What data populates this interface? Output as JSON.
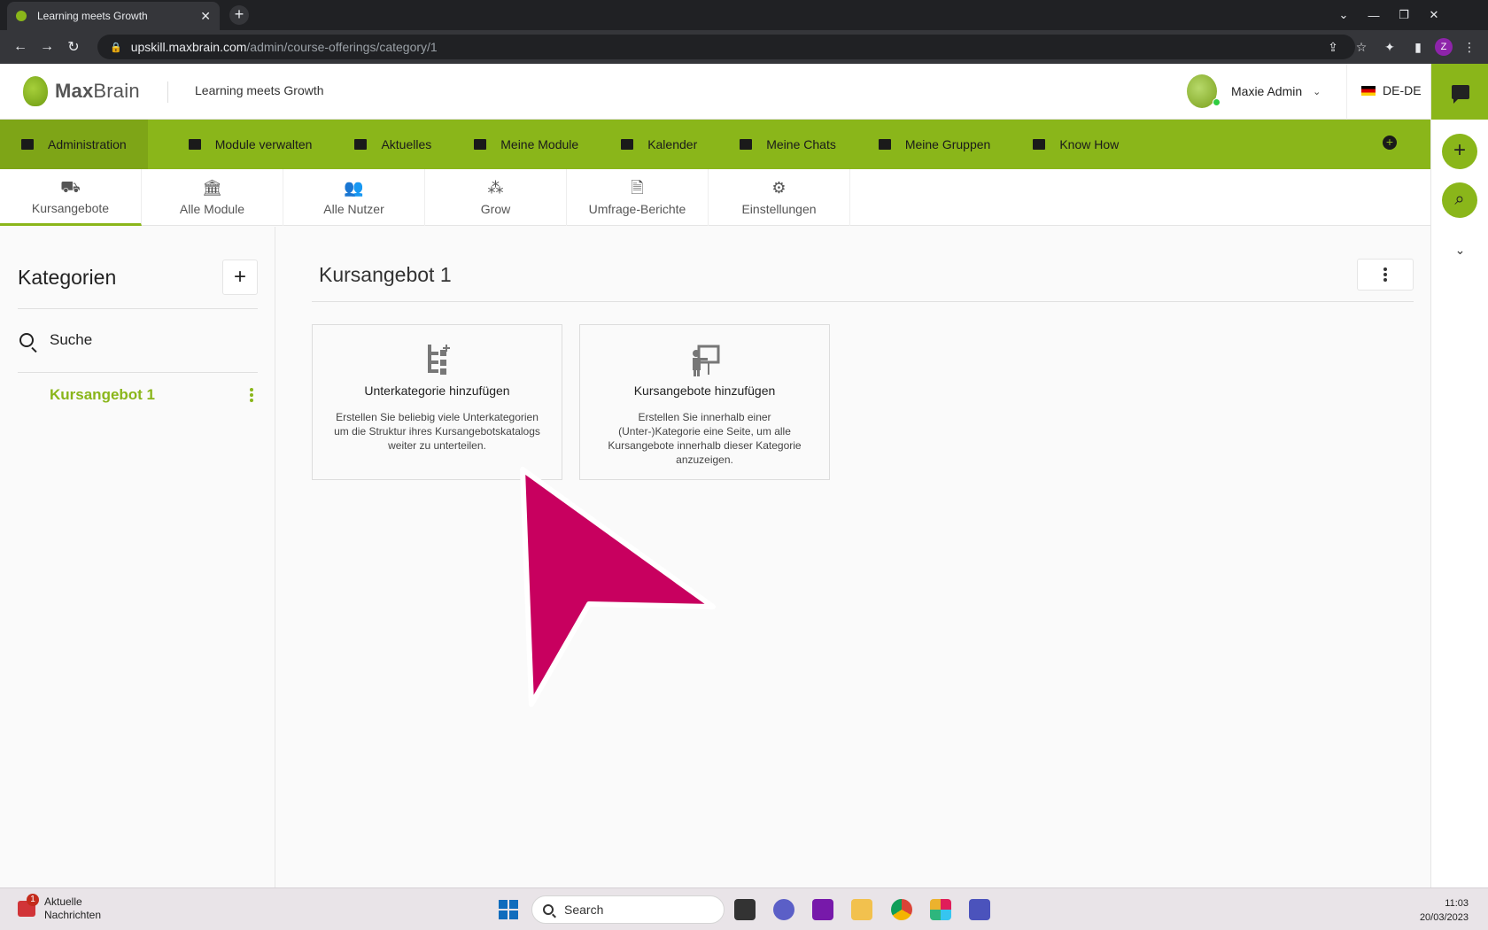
{
  "browser": {
    "tab_title": "Learning meets Growth",
    "url_host": "upskill.maxbrain.com",
    "url_path": "/admin/course-offerings/category/1",
    "profile_initial": "Z"
  },
  "header": {
    "logo_bold": "Max",
    "logo_light": "Brain",
    "tagline": "Learning meets Growth",
    "user_name": "Maxie Admin",
    "language": "DE-DE"
  },
  "nav": {
    "items": [
      {
        "label": "Administration",
        "icon": "dashboard-icon"
      },
      {
        "label": "Module verwalten",
        "icon": "module-manage-icon"
      },
      {
        "label": "Aktuelles",
        "icon": "news-icon"
      },
      {
        "label": "Meine Module",
        "icon": "graduation-cap-icon"
      },
      {
        "label": "Kalender",
        "icon": "calendar-icon"
      },
      {
        "label": "Meine Chats",
        "icon": "chat-screen-icon"
      },
      {
        "label": "Meine Gruppen",
        "icon": "groups-icon"
      },
      {
        "label": "Know How",
        "icon": "book-icon"
      }
    ]
  },
  "subtabs": [
    {
      "label": "Kursangebote",
      "icon": "course-offering-icon"
    },
    {
      "label": "Alle Module",
      "icon": "institution-icon"
    },
    {
      "label": "Alle Nutzer",
      "icon": "users-icon"
    },
    {
      "label": "Grow",
      "icon": "grow-icon"
    },
    {
      "label": "Umfrage-Berichte",
      "icon": "report-icon"
    },
    {
      "label": "Einstellungen",
      "icon": "gears-icon"
    }
  ],
  "sidebar": {
    "title": "Kategorien",
    "search_label": "Suche",
    "items": [
      {
        "label": "Kursangebot 1"
      }
    ]
  },
  "main": {
    "title": "Kursangebot 1",
    "cards": [
      {
        "title": "Unterkategorie hinzufügen",
        "description": "Erstellen Sie beliebig viele Unterkategorien um die Struktur ihres Kursangebotskatalogs weiter zu unterteilen."
      },
      {
        "title": "Kursangebote hinzufügen",
        "description": "Erstellen Sie innerhalb einer (Unter-)Kategorie eine Seite, um alle Kursangebote innerhalb dieser Kategorie anzuzeigen."
      }
    ]
  },
  "taskbar": {
    "news_line1": "Aktuelle",
    "news_line2": "Nachrichten",
    "news_badge": "1",
    "search_label": "Search",
    "time": "11:03",
    "date": "20/03/2023"
  },
  "colors": {
    "brand_green": "#8ab61a",
    "cursor_magenta": "#c8005f"
  }
}
